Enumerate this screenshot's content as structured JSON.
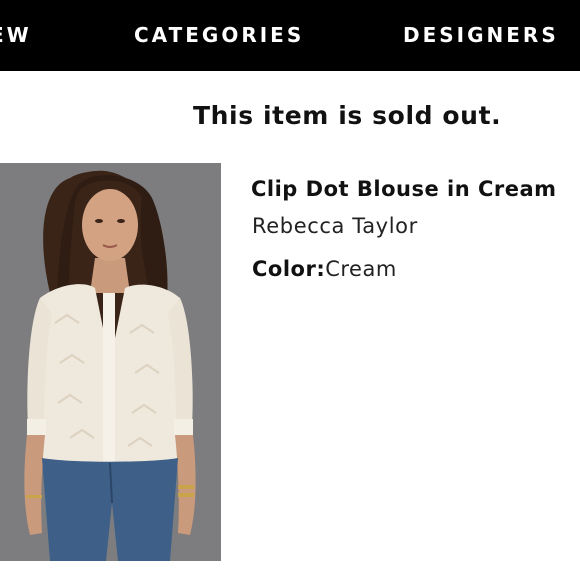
{
  "nav": {
    "items": [
      {
        "label": "EW"
      },
      {
        "label": "CATEGORIES"
      },
      {
        "label": "DESIGNERS"
      }
    ]
  },
  "notice": {
    "sold_out": "This item is sold out."
  },
  "product": {
    "title": "Clip Dot Blouse in Cream",
    "designer": "Rebecca Taylor",
    "color_label": "Color:",
    "color_value": "Cream"
  },
  "colors": {
    "nav_background": "#000000",
    "nav_text": "#ffffff",
    "image_background": "#7f7f81"
  }
}
